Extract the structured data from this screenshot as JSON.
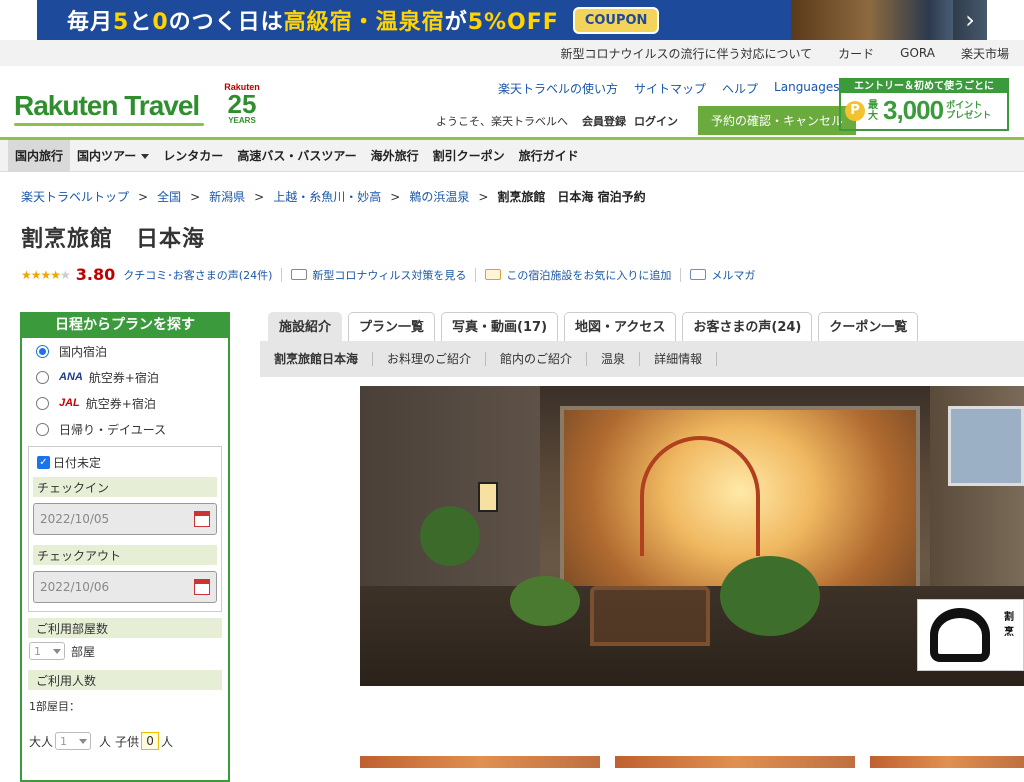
{
  "banner": {
    "text_pre": "毎月",
    "text_5": "5",
    "text_to": "と",
    "text_0": "0",
    "text_mid": "のつく日は",
    "text_hl": "高級宿・温泉宿",
    "text_ga": "が",
    "text_off": "5%OFF",
    "coupon": "COUPON"
  },
  "util": {
    "links": [
      "新型コロナウイルスの流行に伴う対応について",
      "カード",
      "GORA",
      "楽天市場"
    ]
  },
  "header": {
    "logo": "Rakuten Travel",
    "years_brand": "Rakuten",
    "years_num": "25",
    "years_label": "YEARS",
    "links": [
      "楽天トラベルの使い方",
      "サイトマップ",
      "ヘルプ",
      "Languages"
    ],
    "welcome": "ようこそ、楽天トラベルへ",
    "register": "会員登録",
    "login": "ログイン",
    "reservation_button": "予約の確認・キャンセル",
    "entry_top": "エントリー＆初めて使うごとに",
    "entry_coin": "P",
    "entry_small": "最大",
    "entry_big": "3,000",
    "entry_pt1": "ポイント",
    "entry_pt2": "プレゼント"
  },
  "nav": {
    "items": [
      "国内旅行",
      "国内ツアー",
      "レンタカー",
      "高速バス・バスツアー",
      "海外旅行",
      "割引クーポン",
      "旅行ガイド"
    ]
  },
  "breadcrumb": {
    "items": [
      "楽天トラベルトップ",
      "全国",
      "新潟県",
      "上越・糸魚川・妙高",
      "鵜の浜温泉"
    ],
    "current": "割烹旅館　日本海 宿泊予約",
    "sep": ">"
  },
  "hotel": {
    "name": "割烹旅館　日本海",
    "stars_filled": "★★★★",
    "stars_empty": "★",
    "score": "3.80",
    "reviews_link": "クチコミ･お客さまの声(24件)",
    "covid_link": "新型コロナウィルス対策を見る",
    "favorite_link": "この宿泊施設をお気に入りに追加",
    "mailmag_link": "メルマガ"
  },
  "sidebar": {
    "title": "日程からプランを探す",
    "options": [
      {
        "prefix": "",
        "label": "国内宿泊"
      },
      {
        "prefix": "ANA",
        "label": "航空券+宿泊"
      },
      {
        "prefix": "JAL",
        "label": "航空券+宿泊"
      },
      {
        "prefix": "",
        "label": "日帰り・デイユース"
      }
    ],
    "date_undecided": "日付未定",
    "checkin_label": "チェックイン",
    "checkin_value": "2022/10/05",
    "checkout_label": "チェックアウト",
    "checkout_value": "2022/10/06",
    "rooms_label": "ご利用部屋数",
    "rooms_value": "1",
    "rooms_unit": "部屋",
    "persons_label": "ご利用人数",
    "room1_label": "1部屋目：",
    "adult_label": "大人",
    "adult_value": "1",
    "person_unit": "人",
    "child_label": "子供",
    "child_value": "0",
    "child_unit": "人"
  },
  "tabs": {
    "items": [
      "施設紹介",
      "プラン一覧",
      "写真・動画(17)",
      "地図・アクセス",
      "お客さまの声(24)",
      "クーポン一覧"
    ]
  },
  "subtabs": {
    "items": [
      "割烹旅館日本海",
      "お料理のご紹介",
      "館内のご紹介",
      "温泉",
      "詳細情報"
    ]
  },
  "photo": {
    "logo_text": "割烹"
  }
}
